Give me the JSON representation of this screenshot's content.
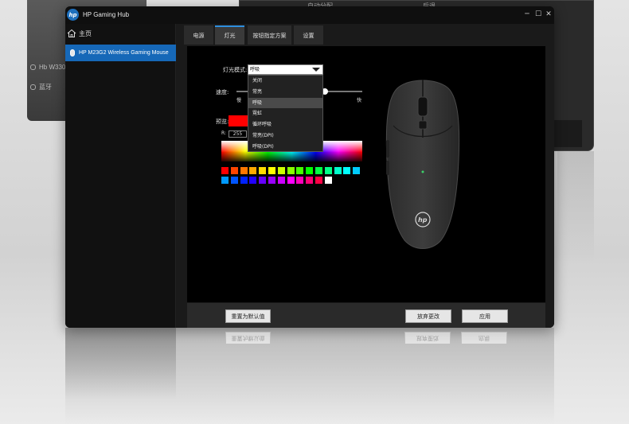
{
  "background": {
    "left_window_items": [
      "Hb W330",
      "蓝牙"
    ],
    "right_window_labels": [
      "自动分配",
      "后退"
    ]
  },
  "app": {
    "title": "HP Gaming Hub",
    "logo_text": "hp",
    "window_controls": [
      "─",
      "☐",
      "✕"
    ]
  },
  "sidebar": {
    "home_label": "主页",
    "device_label": "HP M23G2 Wireless Gaming Mouse"
  },
  "tabs": [
    {
      "label": "电源",
      "active": false
    },
    {
      "label": "灯光",
      "active": true
    },
    {
      "label": "按钮指定方案",
      "active": false
    },
    {
      "label": "设置",
      "active": false
    }
  ],
  "lighting": {
    "mode_label": "灯光模式:",
    "mode_selected": "呼吸",
    "mode_options": [
      "关闭",
      "常亮",
      "呼吸",
      "霓虹",
      "循环呼吸",
      "常亮(DPI)",
      "呼吸(DPI)"
    ],
    "speed_label": "速度:",
    "speed_min_label": "慢",
    "speed_max_label": "快",
    "speed_value_fraction": 0.7,
    "preview_label": "预览:",
    "preview_color": "#ff0000",
    "r_label": "R:",
    "r_value": "255",
    "palette_row1": [
      "#ff0000",
      "#ff4400",
      "#ff7700",
      "#ffaa00",
      "#ffdd00",
      "#ffff00",
      "#ccff00",
      "#88ff00",
      "#44ff00",
      "#00ff00",
      "#00ff44",
      "#00ff88",
      "#00ffcc",
      "#00ffff",
      "#00ccff"
    ],
    "palette_row2": [
      "#0099ff",
      "#0055ff",
      "#0022ff",
      "#2200ff",
      "#6600ff",
      "#9900ff",
      "#cc00ff",
      "#ff00ff",
      "#ff00bb",
      "#ff0077",
      "#ff0044",
      "#ffffff"
    ]
  },
  "mouse": {
    "logo_text": "hp"
  },
  "actions": {
    "reset_label": "重置为默认值",
    "discard_label": "放弃更改",
    "apply_label": "应用"
  },
  "colors": {
    "accent": "#1668b8",
    "tab_active_border": "#2f8fde"
  }
}
